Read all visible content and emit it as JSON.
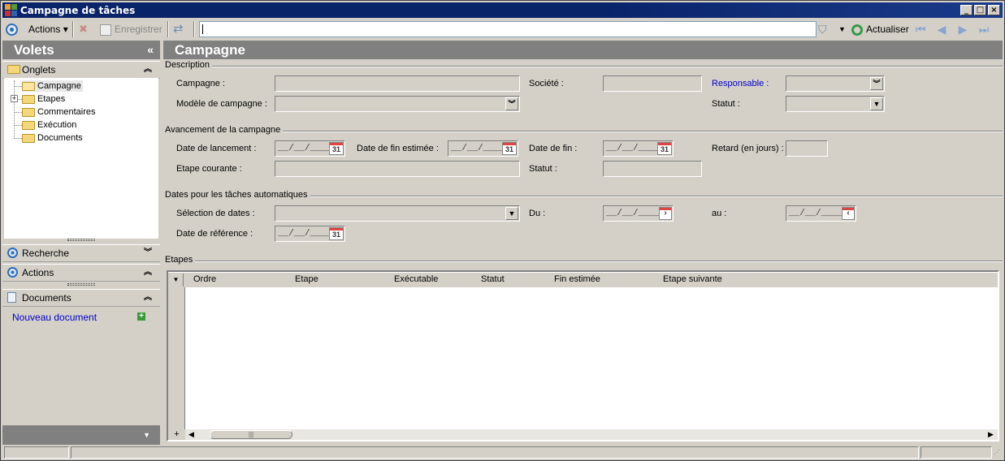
{
  "window": {
    "title": "Campagne de tâches"
  },
  "toolbar": {
    "actions_label": "Actions",
    "save_label": "Enregistrer",
    "refresh_label": "Actualiser",
    "search_value": ""
  },
  "left": {
    "volets_title": "Volets",
    "onglets_title": "Onglets",
    "tree": [
      "Campagne",
      "Etapes",
      "Commentaires",
      "Exécution",
      "Documents"
    ],
    "recherche_title": "Recherche",
    "actions_title": "Actions",
    "documents_title": "Documents",
    "new_document": "Nouveau document"
  },
  "main": {
    "title": "Campagne",
    "description": {
      "title": "Description",
      "campagne_label": "Campagne :",
      "societe_label": "Société :",
      "responsable_label": "Responsable :",
      "modele_label": "Modèle de campagne :",
      "statut_label": "Statut :"
    },
    "avancement": {
      "title": "Avancement de la campagne",
      "lancement_label": "Date de lancement :",
      "fin_estimee_label": "Date de fin estimée :",
      "fin_label": "Date de fin :",
      "retard_label": "Retard (en jours) :",
      "etape_courante_label": "Etape courante :",
      "statut_label": "Statut :"
    },
    "dates_auto": {
      "title": "Dates pour les tâches automatiques",
      "selection_label": "Sélection de dates :",
      "du_label": "Du :",
      "au_label": "au :",
      "reference_label": "Date de référence :"
    },
    "date_mask": "__/__/____",
    "calendar_day": "31",
    "etapes": {
      "title": "Etapes",
      "columns": [
        "Ordre",
        "Etape",
        "Exécutable",
        "Statut",
        "Fin estimée",
        "Etape suivante"
      ]
    }
  },
  "colors": {
    "titlebar": "#0a246a",
    "panel_header": "#808080",
    "link": "#0000cc"
  }
}
